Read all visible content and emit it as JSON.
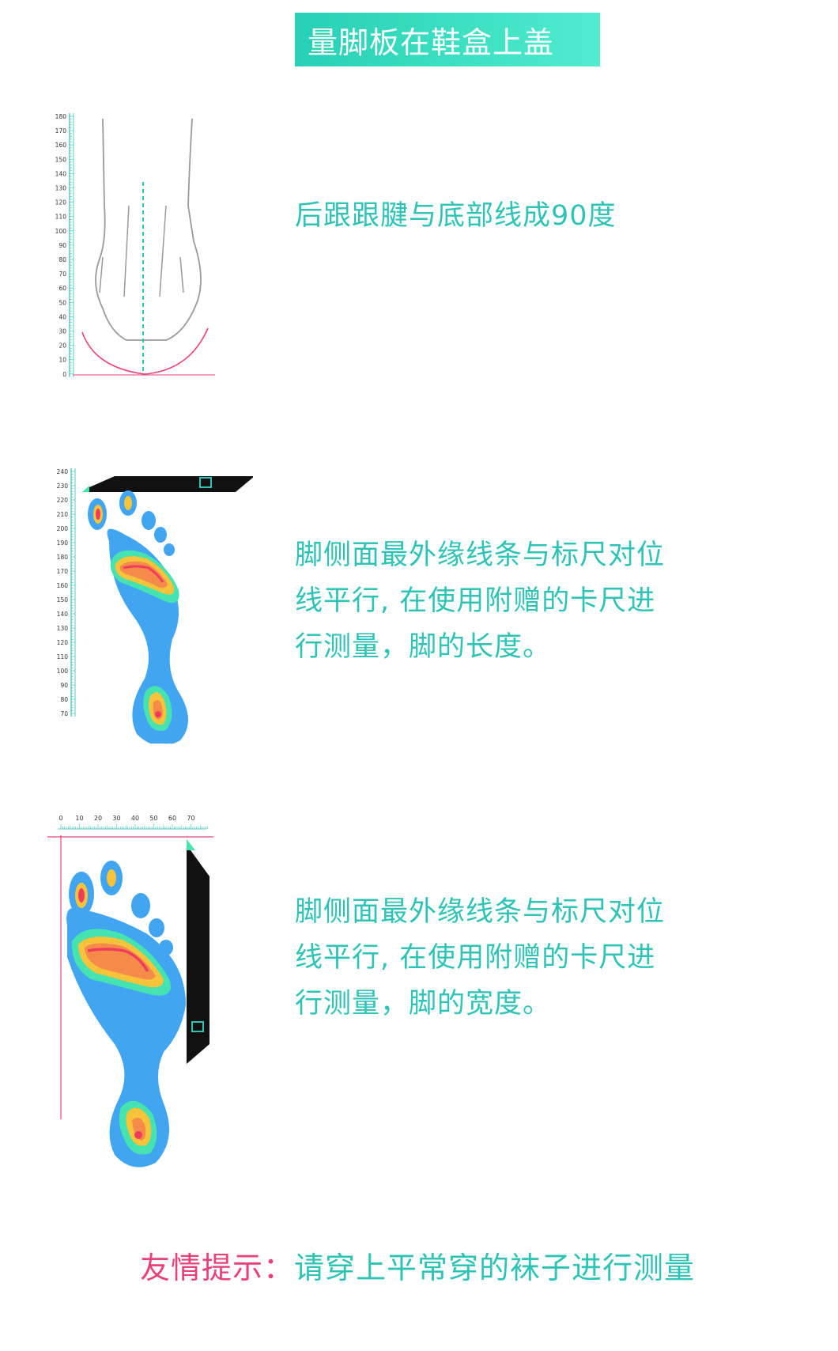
{
  "title": "量脚板在鞋盒上盖",
  "section1": {
    "text_lines": [
      "后跟跟腱与底部线成90度"
    ],
    "ruler_ticks": [
      "180",
      "170",
      "160",
      "150",
      "140",
      "130",
      "120",
      "110",
      "100",
      "90",
      "80",
      "70",
      "60",
      "50",
      "40",
      "30",
      "20",
      "10",
      "0"
    ]
  },
  "section2": {
    "text_lines": [
      "脚侧面最外缘线条与标尺对位",
      "线平行, 在使用附赠的卡尺进",
      "行测量，脚的长度。"
    ],
    "ruler_ticks": [
      "240",
      "230",
      "220",
      "210",
      "200",
      "190",
      "180",
      "170",
      "160",
      "150",
      "140",
      "130",
      "120",
      "110",
      "100",
      "90",
      "80",
      "70"
    ]
  },
  "section3": {
    "text_lines": [
      "脚侧面最外缘线条与标尺对位",
      "线平行, 在使用附赠的卡尺进",
      "行测量，脚的宽度。"
    ],
    "ruler_ticks": [
      "0",
      "10",
      "20",
      "30",
      "40",
      "50",
      "60",
      "70"
    ]
  },
  "tip": {
    "label": "友情提示：",
    "body": "请穿上平常穿的袜子进行测量"
  },
  "colors": {
    "teal": "#2ec3b5",
    "pink": "#e8417a",
    "heat_blue": "#41a5f2",
    "heat_green": "#45e3b0",
    "heat_yellow": "#f6c33a",
    "heat_orange": "#f58b4b",
    "heat_red": "#ef3c5c"
  }
}
